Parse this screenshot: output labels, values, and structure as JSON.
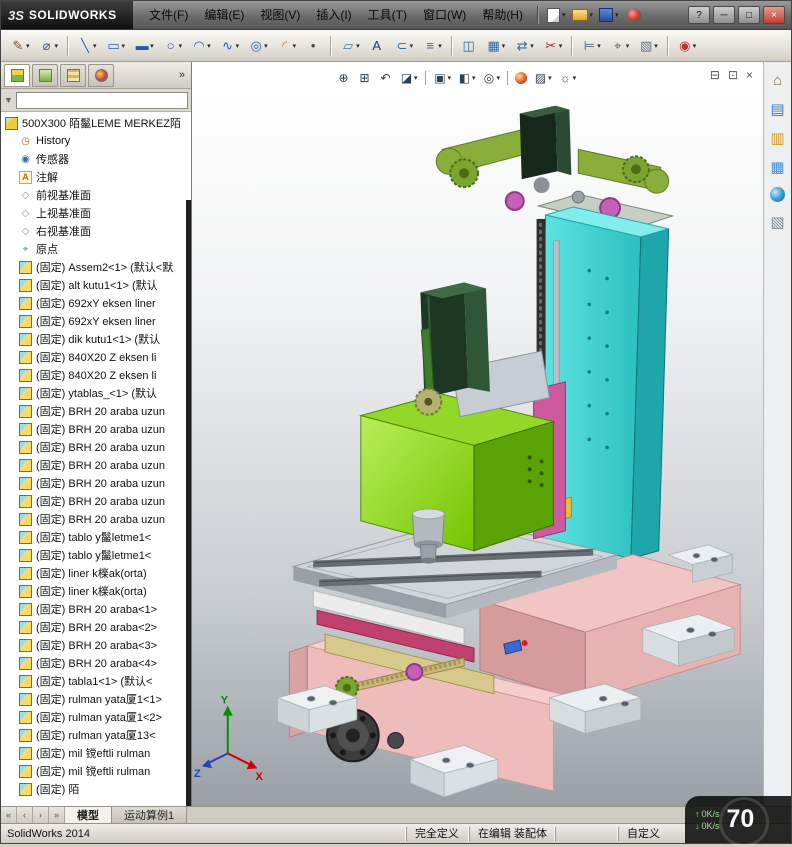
{
  "window": {
    "logo_mark": "3S",
    "logo_text": "SOLIDWORKS",
    "menus": [
      "文件(F)",
      "编辑(E)",
      "视图(V)",
      "插入(I)",
      "工具(T)",
      "窗口(W)",
      "帮助(H)"
    ],
    "controls": {
      "help": "?",
      "minimize": "─",
      "maximize": "□",
      "close": "×"
    }
  },
  "toolbar": {
    "items": [
      {
        "name": "sketch",
        "glyph": "✎",
        "color": "#7a5230",
        "dd": true
      },
      {
        "name": "smart-dimension",
        "glyph": "⌀",
        "color": "#3a5a8a",
        "dd": true
      },
      {
        "sep": true
      },
      {
        "name": "line",
        "glyph": "╲",
        "color": "#2a5aaa",
        "dd": true
      },
      {
        "name": "corner-rectangle",
        "glyph": "▭",
        "color": "#2a5aaa",
        "dd": true
      },
      {
        "name": "straight-slot",
        "glyph": "▬",
        "color": "#2a5aaa",
        "dd": true
      },
      {
        "name": "circle",
        "glyph": "○",
        "color": "#2a5aaa",
        "dd": true
      },
      {
        "name": "centerpoint-arc",
        "glyph": "◠",
        "color": "#2a5aaa",
        "dd": true
      },
      {
        "name": "spline",
        "glyph": "∿",
        "color": "#2255cc",
        "dd": true
      },
      {
        "name": "ellipse",
        "glyph": "◎",
        "color": "#2a5aaa",
        "dd": true
      },
      {
        "name": "sketch-fillet",
        "glyph": "◜",
        "color": "#c07a20",
        "dd": true
      },
      {
        "name": "point",
        "glyph": "•",
        "color": "#444444",
        "dd": false
      },
      {
        "sep": true
      },
      {
        "name": "reference-plane",
        "glyph": "▱",
        "color": "#557799",
        "dd": true
      },
      {
        "name": "text",
        "glyph": "A",
        "color": "#223388",
        "dd": false
      },
      {
        "name": "convert-entities",
        "glyph": "⊂",
        "color": "#336699",
        "dd": true
      },
      {
        "name": "offset-entities",
        "glyph": "≡",
        "color": "#336699",
        "dd": true
      },
      {
        "sep": true
      },
      {
        "name": "mirror-entities",
        "glyph": "◫",
        "color": "#336699",
        "dd": false
      },
      {
        "name": "linear-sketch-pattern",
        "glyph": "▦",
        "color": "#336699",
        "dd": true
      },
      {
        "name": "move-entities",
        "glyph": "⇄",
        "color": "#336699",
        "dd": true
      },
      {
        "name": "trim-entities",
        "glyph": "✂",
        "color": "#aa3333",
        "dd": true
      },
      {
        "sep": true
      },
      {
        "name": "display-relations",
        "glyph": "⊨",
        "color": "#556677",
        "dd": true
      },
      {
        "name": "quick-snaps",
        "glyph": "⌖",
        "color": "#556677",
        "dd": true
      },
      {
        "name": "sketch-picture",
        "glyph": "▧",
        "color": "#667788",
        "dd": true
      },
      {
        "sep": true
      },
      {
        "name": "rapid-sketch",
        "glyph": "◉",
        "color": "#bb3333",
        "dd": true
      }
    ]
  },
  "panel": {
    "filter_value": "",
    "tree": {
      "icon_glyphs": {
        "assembly": "",
        "component": "",
        "history": "◷",
        "sensors": "◉",
        "annotations": "A",
        "plane": "◇",
        "origin": "⌖"
      },
      "items": [
        {
          "icon": "assembly",
          "label": "500X300 陌鬣LEME MERKEZ陌"
        },
        {
          "icon": "history",
          "label": "History"
        },
        {
          "icon": "sensors",
          "label": "传感器"
        },
        {
          "icon": "annotations",
          "label": "注解"
        },
        {
          "icon": "plane",
          "label": "前视基准面"
        },
        {
          "icon": "plane",
          "label": "上视基准面"
        },
        {
          "icon": "plane",
          "label": "右视基准面"
        },
        {
          "icon": "origin",
          "label": "原点"
        },
        {
          "icon": "component",
          "label": "(固定) Assem2<1> (默认<默"
        },
        {
          "icon": "component",
          "label": "(固定) alt kutu1<1> (默认"
        },
        {
          "icon": "component",
          "label": "(固定) 692xY eksen liner"
        },
        {
          "icon": "component",
          "label": "(固定) 692xY eksen liner"
        },
        {
          "icon": "component",
          "label": "(固定) dik kutu1<1> (默认"
        },
        {
          "icon": "component",
          "label": "(固定) 840X20 Z eksen li"
        },
        {
          "icon": "component",
          "label": "(固定) 840X20 Z eksen li"
        },
        {
          "icon": "component",
          "label": "(固定) ytablas_<1> (默认"
        },
        {
          "icon": "component",
          "label": "(固定) BRH 20 araba uzun"
        },
        {
          "icon": "component",
          "label": "(固定) BRH 20 araba uzun"
        },
        {
          "icon": "component",
          "label": "(固定) BRH 20 araba uzun"
        },
        {
          "icon": "component",
          "label": "(固定) BRH 20 araba uzun"
        },
        {
          "icon": "component",
          "label": "(固定) BRH 20 araba uzun"
        },
        {
          "icon": "component",
          "label": "(固定) BRH 20 araba uzun"
        },
        {
          "icon": "component",
          "label": "(固定) BRH 20 araba uzun"
        },
        {
          "icon": "component",
          "label": "(固定) tablo y鬣letme1<"
        },
        {
          "icon": "component",
          "label": "(固定) tablo y鬣letme1<"
        },
        {
          "icon": "component",
          "label": "(固定) liner k檪ak(orta)"
        },
        {
          "icon": "component",
          "label": "(固定) liner k檪ak(orta)"
        },
        {
          "icon": "component",
          "label": "(固定) BRH 20 araba<1>"
        },
        {
          "icon": "component",
          "label": "(固定) BRH 20 araba<2>"
        },
        {
          "icon": "component",
          "label": "(固定) BRH 20 araba<3>"
        },
        {
          "icon": "component",
          "label": "(固定) BRH 20 araba<4>"
        },
        {
          "icon": "component",
          "label": "(固定) tabla1<1> (默认<"
        },
        {
          "icon": "component",
          "label": "(固定) rulman yata厦1<1>"
        },
        {
          "icon": "component",
          "label": "(固定) rulman yata厦1<2>"
        },
        {
          "icon": "component",
          "label": "(固定) rulman yata厦13<"
        },
        {
          "icon": "component",
          "label": "(固定) mil 镋eftli rulman"
        },
        {
          "icon": "component",
          "label": "(固定) mil 镋eftli rulman"
        },
        {
          "icon": "component",
          "label": "(固定) 陌"
        }
      ]
    }
  },
  "viewport": {
    "toolbar": [
      {
        "name": "zoom-to-fit",
        "glyph": "⊕"
      },
      {
        "name": "zoom-to-area",
        "glyph": "⊞"
      },
      {
        "name": "previous-view",
        "glyph": "↶"
      },
      {
        "name": "section-view",
        "glyph": "◪",
        "dd": true
      },
      {
        "sep": true
      },
      {
        "name": "view-orientation",
        "glyph": "▣",
        "dd": true
      },
      {
        "name": "display-style",
        "glyph": "◧",
        "dd": true
      },
      {
        "name": "hide-show-items",
        "glyph": "◎",
        "dd": true
      },
      {
        "sep": true
      },
      {
        "name": "edit-appearance",
        "ball": true
      },
      {
        "name": "apply-scene",
        "glyph": "▨",
        "dd": true
      },
      {
        "name": "view-settings",
        "glyph": "☼",
        "dd": true
      }
    ],
    "window_buttons": [
      {
        "name": "document-minimize",
        "glyph": "⊟"
      },
      {
        "name": "document-restore",
        "glyph": "⊡"
      },
      {
        "name": "document-close",
        "glyph": "×"
      }
    ],
    "triad": {
      "x": "X",
      "y": "Y",
      "z": "Z"
    }
  },
  "taskpane": {
    "icons": [
      {
        "name": "solidworks-resources",
        "glyph": "⌂",
        "color": "#8a6a4a"
      },
      {
        "name": "design-library",
        "glyph": "▤",
        "color": "#3a7abd"
      },
      {
        "name": "file-explorer",
        "glyph": "▥",
        "color": "#d09a20"
      },
      {
        "name": "view-palette",
        "glyph": "▦",
        "color": "#4a8ad4"
      },
      {
        "name": "appearances",
        "ball": true
      },
      {
        "name": "custom-properties",
        "glyph": "▧",
        "color": "#7a8a9a"
      }
    ]
  },
  "tabs": {
    "nav": [
      "«",
      "‹",
      "›",
      "»"
    ],
    "items": [
      "模型",
      "运动算例1"
    ]
  },
  "statusbar": {
    "left": "SolidWorks 2014",
    "cells": [
      "完全定义",
      "在编辑 装配体",
      "",
      "自定义"
    ]
  },
  "overlay": {
    "up": "0K/s",
    "down": "0K/s",
    "big": "70"
  },
  "colors": {
    "column_cyan": "#3ad0d0",
    "head_green": "#86d30a",
    "base_pink": "#f0bcbc",
    "beam_olive": "#8aae3c",
    "motor_green": "#23422a",
    "pulley_magenta": "#c75fb8",
    "table_gray": "#d2d6da"
  }
}
